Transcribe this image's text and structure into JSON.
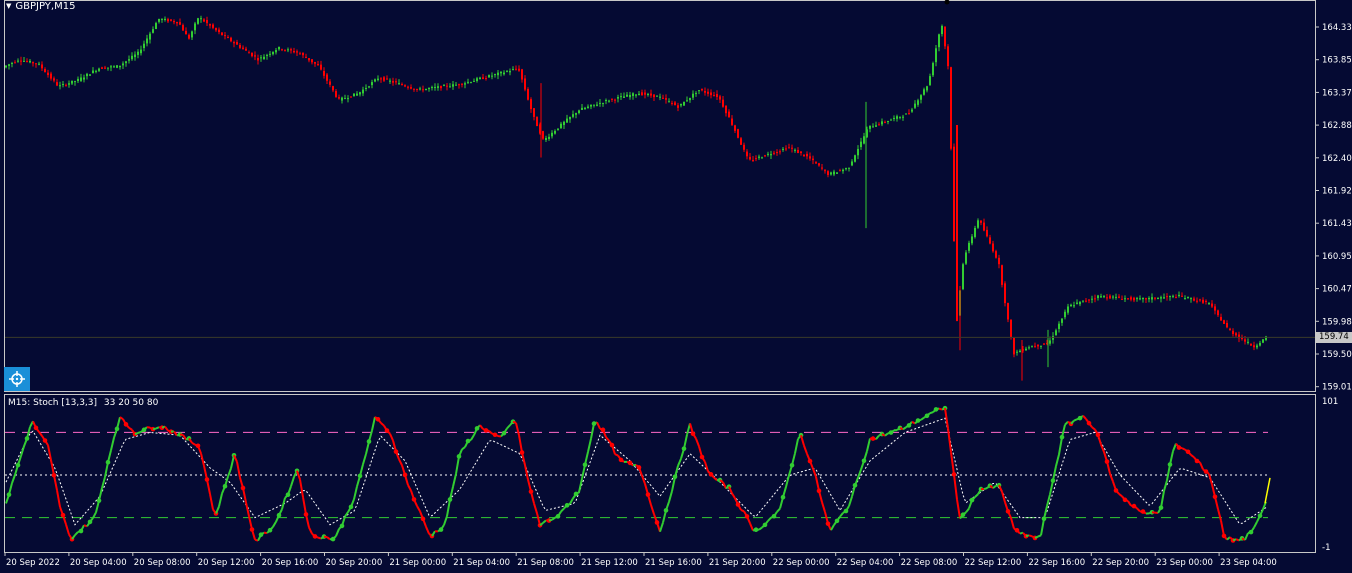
{
  "chart": {
    "symbol": "GBPJPY,M15",
    "indicator_label": "M15: Stoch [13,3,3]",
    "indicator_params": "33 20 50 80",
    "current_price": "159.74",
    "price_axis_ticks": [
      "164.33",
      "163.85",
      "163.37",
      "162.88",
      "162.40",
      "161.92",
      "161.43",
      "160.95",
      "160.47",
      "159.98",
      "159.50",
      "159.01"
    ],
    "ind_axis_ticks": [
      "101",
      "-1"
    ],
    "time_axis_labels": [
      "20 Sep 2022",
      "20 Sep 04:00",
      "20 Sep 08:00",
      "20 Sep 12:00",
      "20 Sep 16:00",
      "20 Sep 20:00",
      "21 Sep 00:00",
      "21 Sep 04:00",
      "21 Sep 08:00",
      "21 Sep 12:00",
      "21 Sep 16:00",
      "21 Sep 20:00",
      "22 Sep 00:00",
      "22 Sep 04:00",
      "22 Sep 08:00",
      "22 Sep 12:00",
      "22 Sep 16:00",
      "22 Sep 20:00",
      "23 Sep 00:00",
      "23 Sep 04:00"
    ],
    "colors": {
      "background": "#050a33",
      "bull": "#32cd32",
      "bear": "#ff0000",
      "stoch_main_up": "#32cd32",
      "stoch_main_down": "#ff0000",
      "stoch_signal": "#ffffff",
      "level_80": "#ff69c8",
      "level_20": "#32cd32",
      "level_50": "#ffffff"
    },
    "icons": {
      "navigator": "crosshair-icon",
      "menu": "triangle-down-icon"
    }
  },
  "chart_data": {
    "type": "candlestick",
    "title": "GBPJPY,M15",
    "ylim": [
      159.01,
      164.33
    ],
    "price_keypoints": [
      [
        0,
        163.7
      ],
      [
        20,
        163.85
      ],
      [
        40,
        163.78
      ],
      [
        60,
        163.45
      ],
      [
        80,
        163.55
      ],
      [
        100,
        163.72
      ],
      [
        120,
        163.75
      ],
      [
        140,
        163.95
      ],
      [
        160,
        164.45
      ],
      [
        180,
        164.4
      ],
      [
        190,
        164.15
      ],
      [
        200,
        164.48
      ],
      [
        220,
        164.25
      ],
      [
        240,
        164.05
      ],
      [
        260,
        163.85
      ],
      [
        280,
        164.02
      ],
      [
        300,
        163.95
      ],
      [
        320,
        163.75
      ],
      [
        340,
        163.25
      ],
      [
        360,
        163.35
      ],
      [
        380,
        163.58
      ],
      [
        420,
        163.4
      ],
      [
        460,
        163.48
      ],
      [
        520,
        163.72
      ],
      [
        535,
        163.0
      ],
      [
        545,
        162.65
      ],
      [
        560,
        162.85
      ],
      [
        580,
        163.1
      ],
      [
        610,
        163.25
      ],
      [
        640,
        163.35
      ],
      [
        660,
        163.3
      ],
      [
        680,
        163.15
      ],
      [
        700,
        163.4
      ],
      [
        720,
        163.3
      ],
      [
        735,
        162.85
      ],
      [
        750,
        162.35
      ],
      [
        770,
        162.45
      ],
      [
        790,
        162.55
      ],
      [
        810,
        162.4
      ],
      [
        830,
        162.15
      ],
      [
        850,
        162.25
      ],
      [
        870,
        162.85
      ],
      [
        890,
        162.95
      ],
      [
        910,
        163.05
      ],
      [
        930,
        163.5
      ],
      [
        943,
        164.4
      ],
      [
        950,
        163.7
      ],
      [
        958,
        160.0
      ],
      [
        965,
        160.9
      ],
      [
        980,
        161.5
      ],
      [
        1000,
        160.85
      ],
      [
        1015,
        159.5
      ],
      [
        1030,
        159.6
      ],
      [
        1050,
        159.65
      ],
      [
        1070,
        160.2
      ],
      [
        1100,
        160.35
      ],
      [
        1140,
        160.3
      ],
      [
        1180,
        160.35
      ],
      [
        1210,
        160.25
      ],
      [
        1230,
        159.85
      ],
      [
        1255,
        159.6
      ],
      [
        1268,
        159.74
      ]
    ],
    "stochastic": {
      "main_keypoints": [
        [
          6,
          30
        ],
        [
          32,
          88
        ],
        [
          48,
          70
        ],
        [
          60,
          28
        ],
        [
          70,
          5
        ],
        [
          95,
          20
        ],
        [
          115,
          80
        ],
        [
          120,
          90
        ],
        [
          135,
          80
        ],
        [
          160,
          85
        ],
        [
          175,
          80
        ],
        [
          200,
          70
        ],
        [
          215,
          20
        ],
        [
          235,
          65
        ],
        [
          255,
          3
        ],
        [
          275,
          15
        ],
        [
          298,
          55
        ],
        [
          310,
          8
        ],
        [
          335,
          5
        ],
        [
          355,
          35
        ],
        [
          375,
          90
        ],
        [
          390,
          80
        ],
        [
          410,
          40
        ],
        [
          430,
          7
        ],
        [
          445,
          15
        ],
        [
          460,
          65
        ],
        [
          480,
          85
        ],
        [
          500,
          75
        ],
        [
          515,
          90
        ],
        [
          530,
          40
        ],
        [
          540,
          15
        ],
        [
          560,
          22
        ],
        [
          580,
          40
        ],
        [
          595,
          90
        ],
        [
          620,
          60
        ],
        [
          640,
          55
        ],
        [
          660,
          10
        ],
        [
          690,
          85
        ],
        [
          710,
          50
        ],
        [
          730,
          40
        ],
        [
          755,
          10
        ],
        [
          780,
          25
        ],
        [
          800,
          80
        ],
        [
          815,
          50
        ],
        [
          830,
          10
        ],
        [
          850,
          30
        ],
        [
          870,
          75
        ],
        [
          900,
          82
        ],
        [
          945,
          98
        ],
        [
          960,
          18
        ],
        [
          980,
          40
        ],
        [
          1000,
          42
        ],
        [
          1015,
          10
        ],
        [
          1040,
          5
        ],
        [
          1065,
          85
        ],
        [
          1085,
          92
        ],
        [
          1100,
          75
        ],
        [
          1115,
          40
        ],
        [
          1130,
          30
        ],
        [
          1145,
          22
        ],
        [
          1160,
          25
        ],
        [
          1175,
          72
        ],
        [
          1190,
          65
        ],
        [
          1210,
          50
        ],
        [
          1225,
          5
        ],
        [
          1245,
          5
        ],
        [
          1260,
          20
        ],
        [
          1268,
          35
        ]
      ],
      "signal_keypoints": [
        [
          6,
          45
        ],
        [
          32,
          82
        ],
        [
          55,
          55
        ],
        [
          75,
          15
        ],
        [
          100,
          35
        ],
        [
          125,
          75
        ],
        [
          150,
          80
        ],
        [
          180,
          78
        ],
        [
          210,
          55
        ],
        [
          230,
          45
        ],
        [
          255,
          20
        ],
        [
          285,
          30
        ],
        [
          305,
          40
        ],
        [
          330,
          15
        ],
        [
          355,
          25
        ],
        [
          380,
          78
        ],
        [
          405,
          60
        ],
        [
          430,
          20
        ],
        [
          460,
          40
        ],
        [
          490,
          75
        ],
        [
          520,
          65
        ],
        [
          545,
          25
        ],
        [
          575,
          30
        ],
        [
          600,
          78
        ],
        [
          630,
          60
        ],
        [
          660,
          35
        ],
        [
          690,
          65
        ],
        [
          720,
          45
        ],
        [
          755,
          20
        ],
        [
          790,
          50
        ],
        [
          815,
          55
        ],
        [
          840,
          25
        ],
        [
          870,
          60
        ],
        [
          905,
          80
        ],
        [
          945,
          90
        ],
        [
          965,
          30
        ],
        [
          995,
          45
        ],
        [
          1020,
          20
        ],
        [
          1045,
          20
        ],
        [
          1070,
          75
        ],
        [
          1095,
          80
        ],
        [
          1120,
          50
        ],
        [
          1150,
          28
        ],
        [
          1180,
          55
        ],
        [
          1210,
          48
        ],
        [
          1240,
          15
        ],
        [
          1268,
          28
        ]
      ]
    }
  }
}
